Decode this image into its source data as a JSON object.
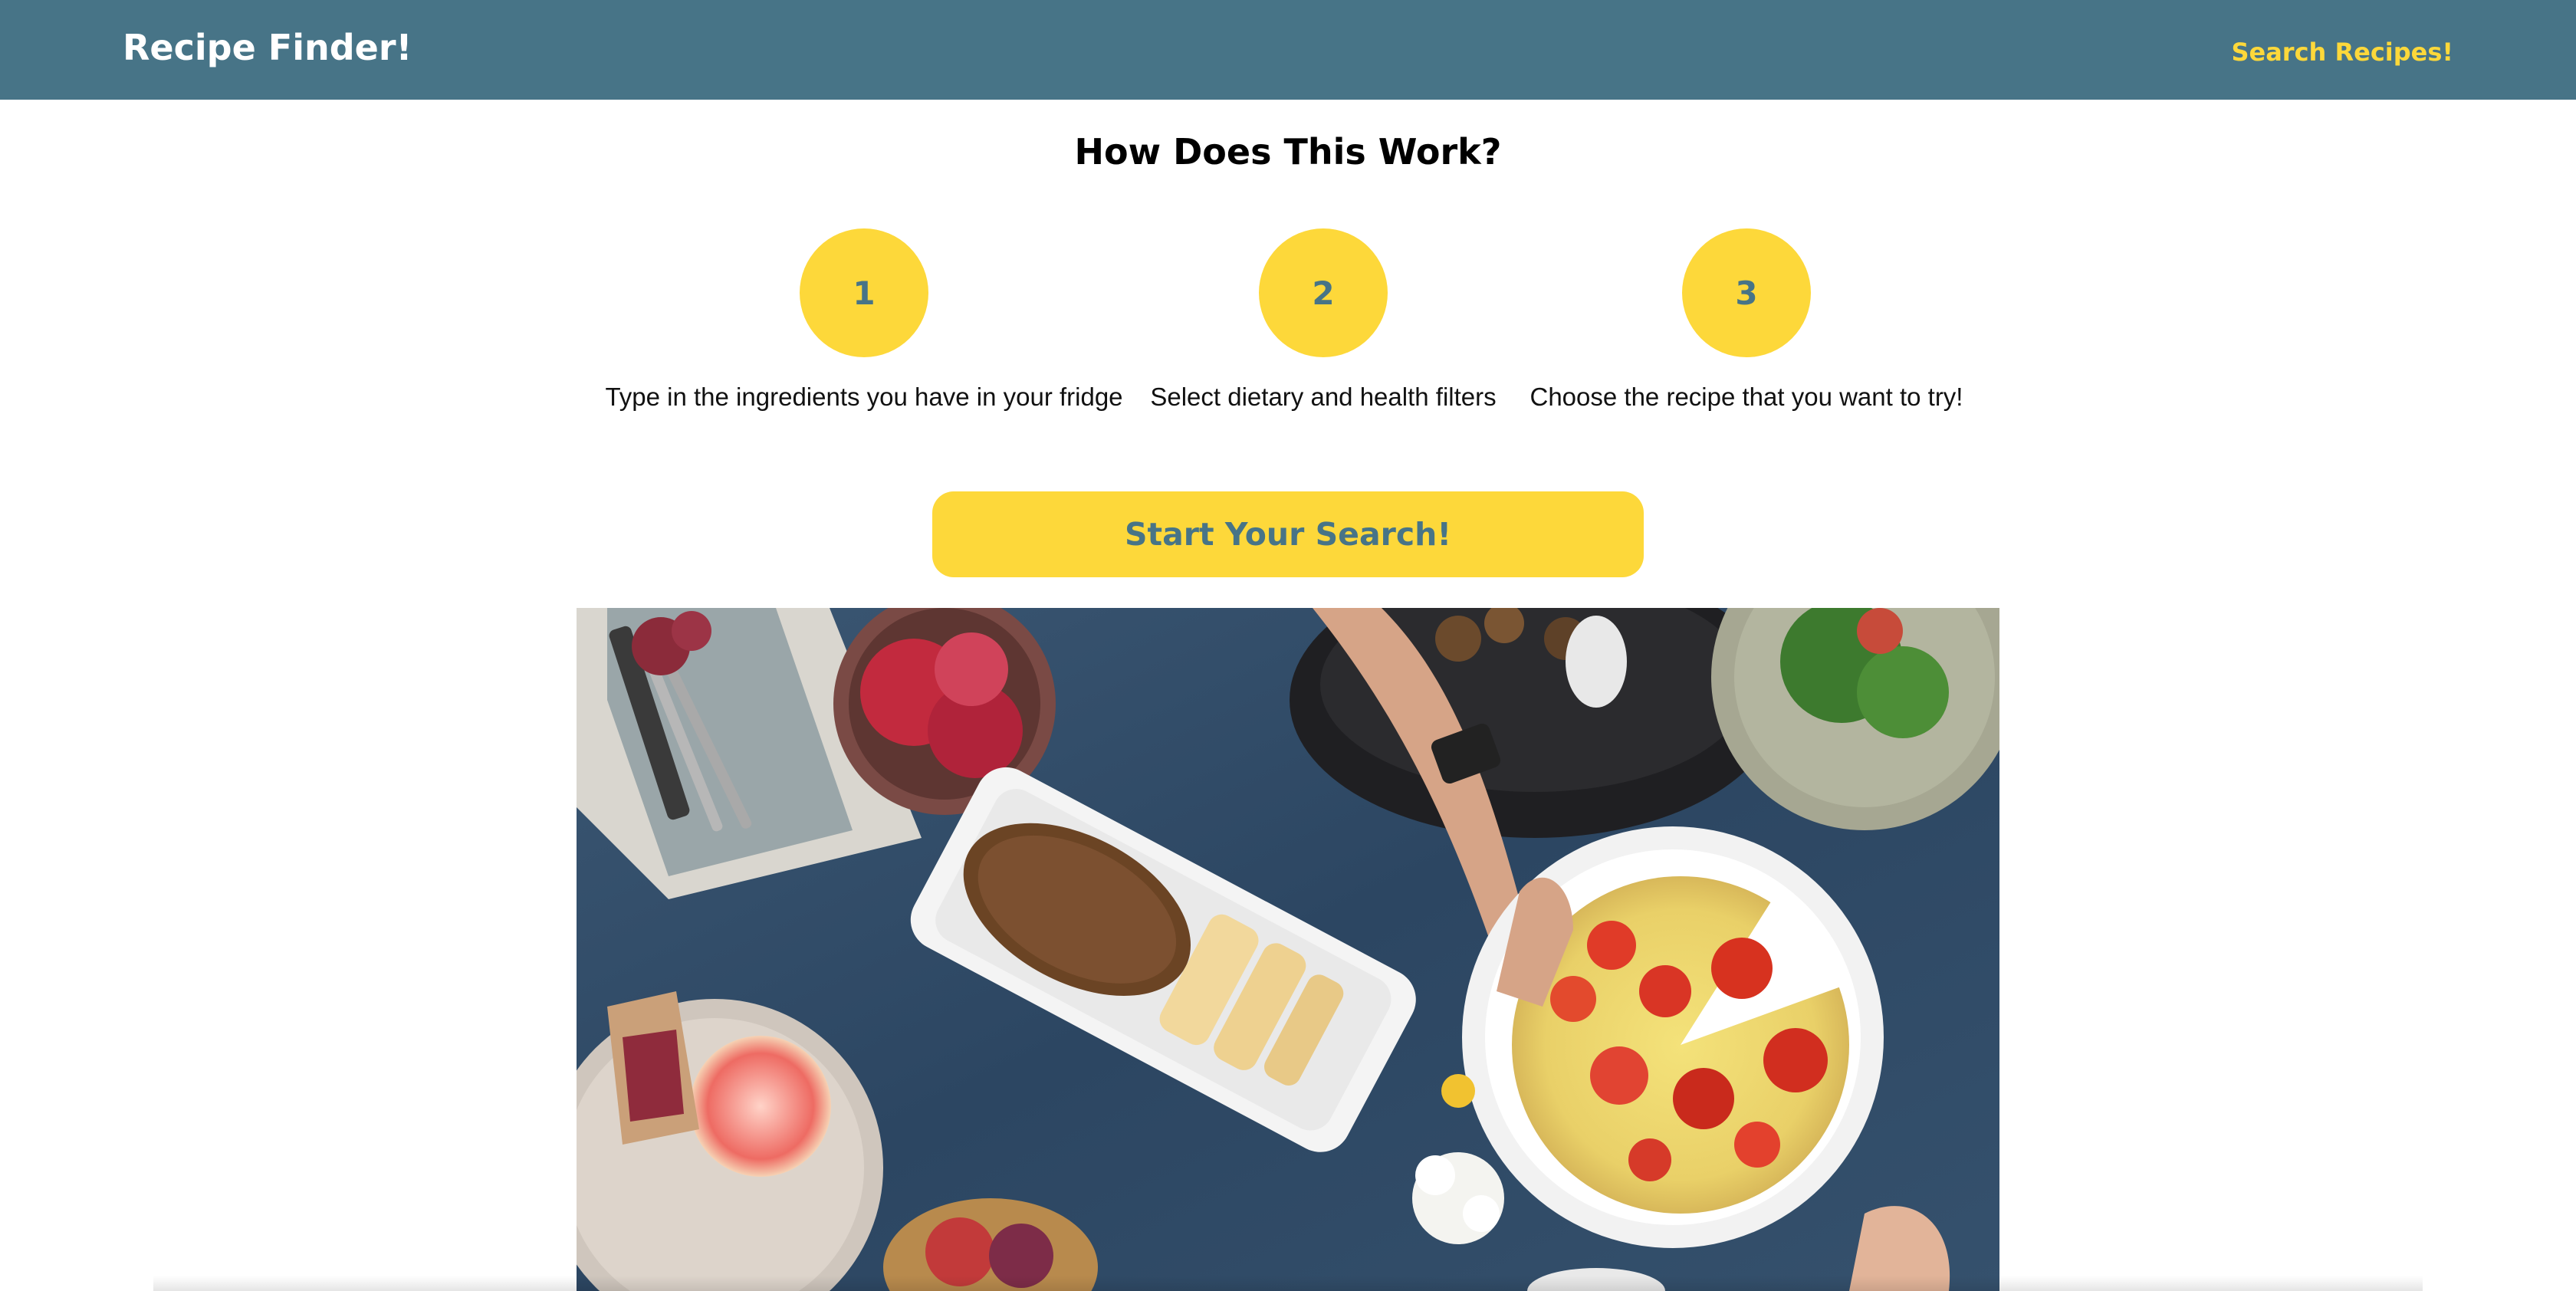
{
  "navbar": {
    "brand": "Recipe Finder!",
    "link": "Search Recipes!"
  },
  "main": {
    "title": "How Does This Work?",
    "steps": [
      {
        "number": "1",
        "text": "Type in the ingredients you have in your fridge"
      },
      {
        "number": "2",
        "text": "Select dietary and health filters"
      },
      {
        "number": "3",
        "text": "Choose the recipe that you want to try!"
      }
    ],
    "cta_label": "Start Your Search!"
  },
  "hero_image": {
    "description_icon": "food-table-photo"
  },
  "colors": {
    "nav_bg": "#477487",
    "accent_yellow": "#fdd83a",
    "step_number": "#477487"
  }
}
